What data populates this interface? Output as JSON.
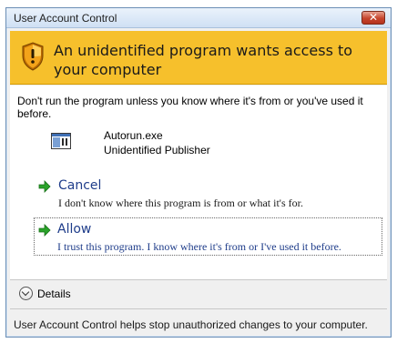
{
  "window": {
    "title": "User Account Control",
    "close_label": "✕"
  },
  "banner": {
    "heading": "An unidentified program wants access to your computer",
    "icon": "shield-warning-icon",
    "color": "#f6c02c"
  },
  "message": "Don't run the program unless you know where it's from or you've used it before.",
  "program": {
    "name": "Autorun.exe",
    "publisher": "Unidentified Publisher",
    "icon": "program-window-icon"
  },
  "options": {
    "cancel": {
      "title": "Cancel",
      "description": "I don't know where this program is from or what it's for."
    },
    "allow": {
      "title": "Allow",
      "description": "I trust this program. I know where it's from or I've used it before."
    }
  },
  "details": {
    "label": "Details"
  },
  "footer": {
    "text": "User Account Control helps stop unauthorized changes to your computer."
  }
}
